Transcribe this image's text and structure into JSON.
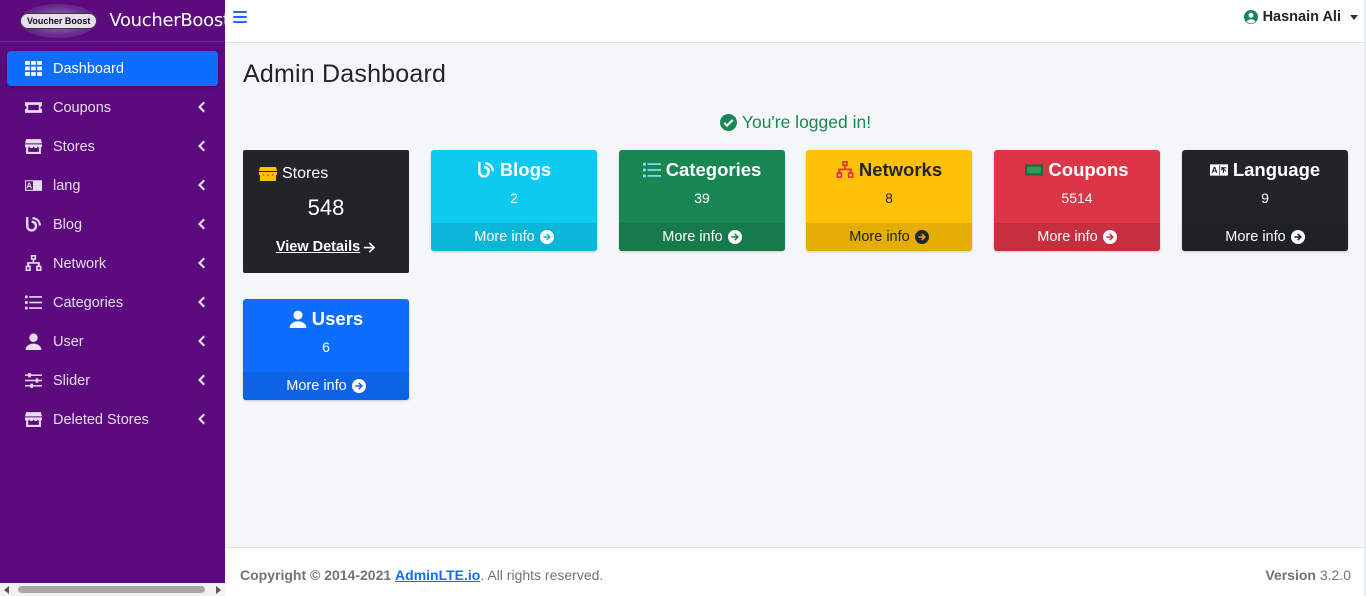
{
  "brand": {
    "logo_text": "Voucher Boost",
    "name": "VoucherBoost"
  },
  "sidebar": {
    "items": [
      {
        "label": "Dashboard",
        "icon": "table-grid-icon",
        "active": true
      },
      {
        "label": "Coupons",
        "icon": "ticket-icon"
      },
      {
        "label": "Stores",
        "icon": "store-icon"
      },
      {
        "label": "lang",
        "icon": "language-icon"
      },
      {
        "label": "Blog",
        "icon": "blog-icon"
      },
      {
        "label": "Network",
        "icon": "network-icon"
      },
      {
        "label": "Categories",
        "icon": "list-icon"
      },
      {
        "label": "User",
        "icon": "user-icon"
      },
      {
        "label": "Slider",
        "icon": "sliders-icon"
      },
      {
        "label": "Deleted Stores",
        "icon": "store-icon"
      }
    ]
  },
  "topbar": {
    "user_name": "Hasnain Ali"
  },
  "main": {
    "title": "Admin Dashboard",
    "logged_message": "You're logged in!",
    "stores_card": {
      "label": "Stores",
      "count": "548",
      "link": "View Details"
    },
    "cards": [
      {
        "key": "blogs",
        "title": "Blogs",
        "count": "2",
        "more": "More info",
        "color": "#0dcaf0",
        "footer_color": "#0cb6d8",
        "text_color": "#ffffff",
        "icon": "blog-icon"
      },
      {
        "key": "categories",
        "title": "Categories",
        "count": "39",
        "more": "More info",
        "color": "#198754",
        "footer_color": "#167a4c",
        "text_color": "#ffffff",
        "icon": "list-icon"
      },
      {
        "key": "networks",
        "title": "Networks",
        "count": "8",
        "more": "More info",
        "color": "#ffc107",
        "footer_color": "#e6ad06",
        "text_color": "#212529",
        "icon": "network-icon"
      },
      {
        "key": "coupons",
        "title": "Coupons",
        "count": "5514",
        "more": "More info",
        "color": "#dc3545",
        "footer_color": "#c6303e",
        "text_color": "#ffffff",
        "icon": "ticket-icon"
      },
      {
        "key": "language",
        "title": "Language",
        "count": "9",
        "more": "More info",
        "color": "#212529",
        "footer_color": "#1e2125",
        "text_color": "#ffffff",
        "icon": "language-icon"
      },
      {
        "key": "users",
        "title": "Users",
        "count": "6",
        "more": "More info",
        "color": "#0d6efd",
        "footer_color": "#0c63e4",
        "text_color": "#ffffff",
        "icon": "user-icon"
      }
    ]
  },
  "footer": {
    "copyright": "Copyright © 2014-2021",
    "link": "AdminLTE.io",
    "rights": ". All rights reserved.",
    "version_label": "Version",
    "version": "3.2.0"
  }
}
